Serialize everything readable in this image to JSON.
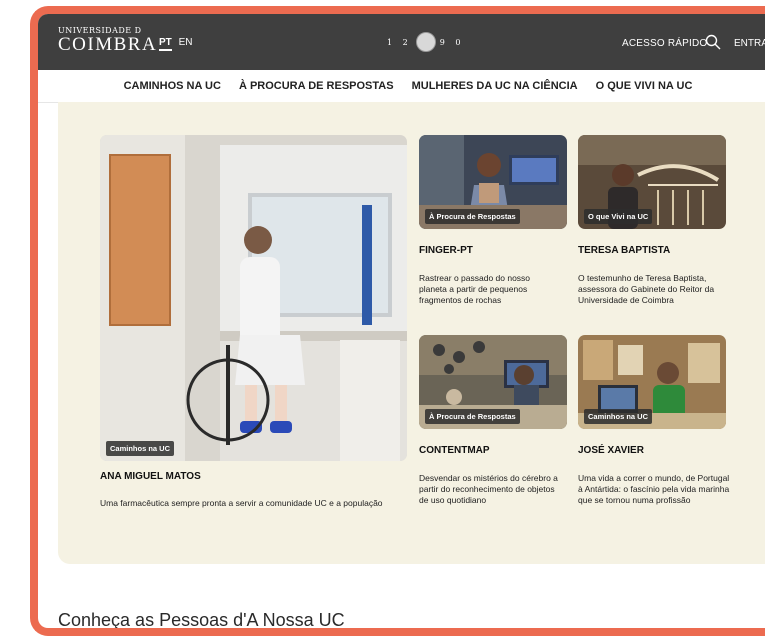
{
  "header": {
    "logo_line1": "UNIVERSIDADE D",
    "logo_line2": "COIMBRA",
    "lang_active": "PT",
    "lang_other": "EN",
    "seal_left": "1 2",
    "seal_right": "9 0",
    "quick_access": "ACESSO RÁPIDO",
    "login": "ENTRAR"
  },
  "nav": {
    "items": [
      "CAMINHOS NA UC",
      "À PROCURA DE RESPOSTAS",
      "MULHERES DA UC NA CIÊNCIA",
      "O QUE VIVI NA UC"
    ]
  },
  "cards": [
    {
      "tag": "Caminhos na UC",
      "title": "ANA MIGUEL MATOS",
      "desc": "Uma farmacêutica sempre pronta a servir a comunidade UC e a população"
    },
    {
      "tag": "À Procura de Respostas",
      "title": "FINGER-PT",
      "desc": "Rastrear o passado do nosso planeta a partir de pequenos fragmentos de rochas"
    },
    {
      "tag": "O que Vivi na UC",
      "title": "TERESA BAPTISTA",
      "desc": "O testemunho de Teresa Baptista, assessora do Gabinete do Reitor da Universidade de Coimbra"
    },
    {
      "tag": "À Procura de Respostas",
      "title": "CONTENTMAP",
      "desc": "Desvendar os mistérios do cérebro a partir do reconhecimento de objetos de uso quotidiano"
    },
    {
      "tag": "Caminhos na UC",
      "title": "JOSÉ XAVIER",
      "desc": "Uma vida a correr o mundo, de Portugal à Antártida: o fascínio pela vida marinha que se tornou numa profissão"
    }
  ],
  "section_heading": "Conheça as Pessoas d'A Nossa UC",
  "colors": {
    "frame": "#ec6b50",
    "header_bg": "#3f3f3f",
    "panel_bg": "#f5f2e3"
  }
}
